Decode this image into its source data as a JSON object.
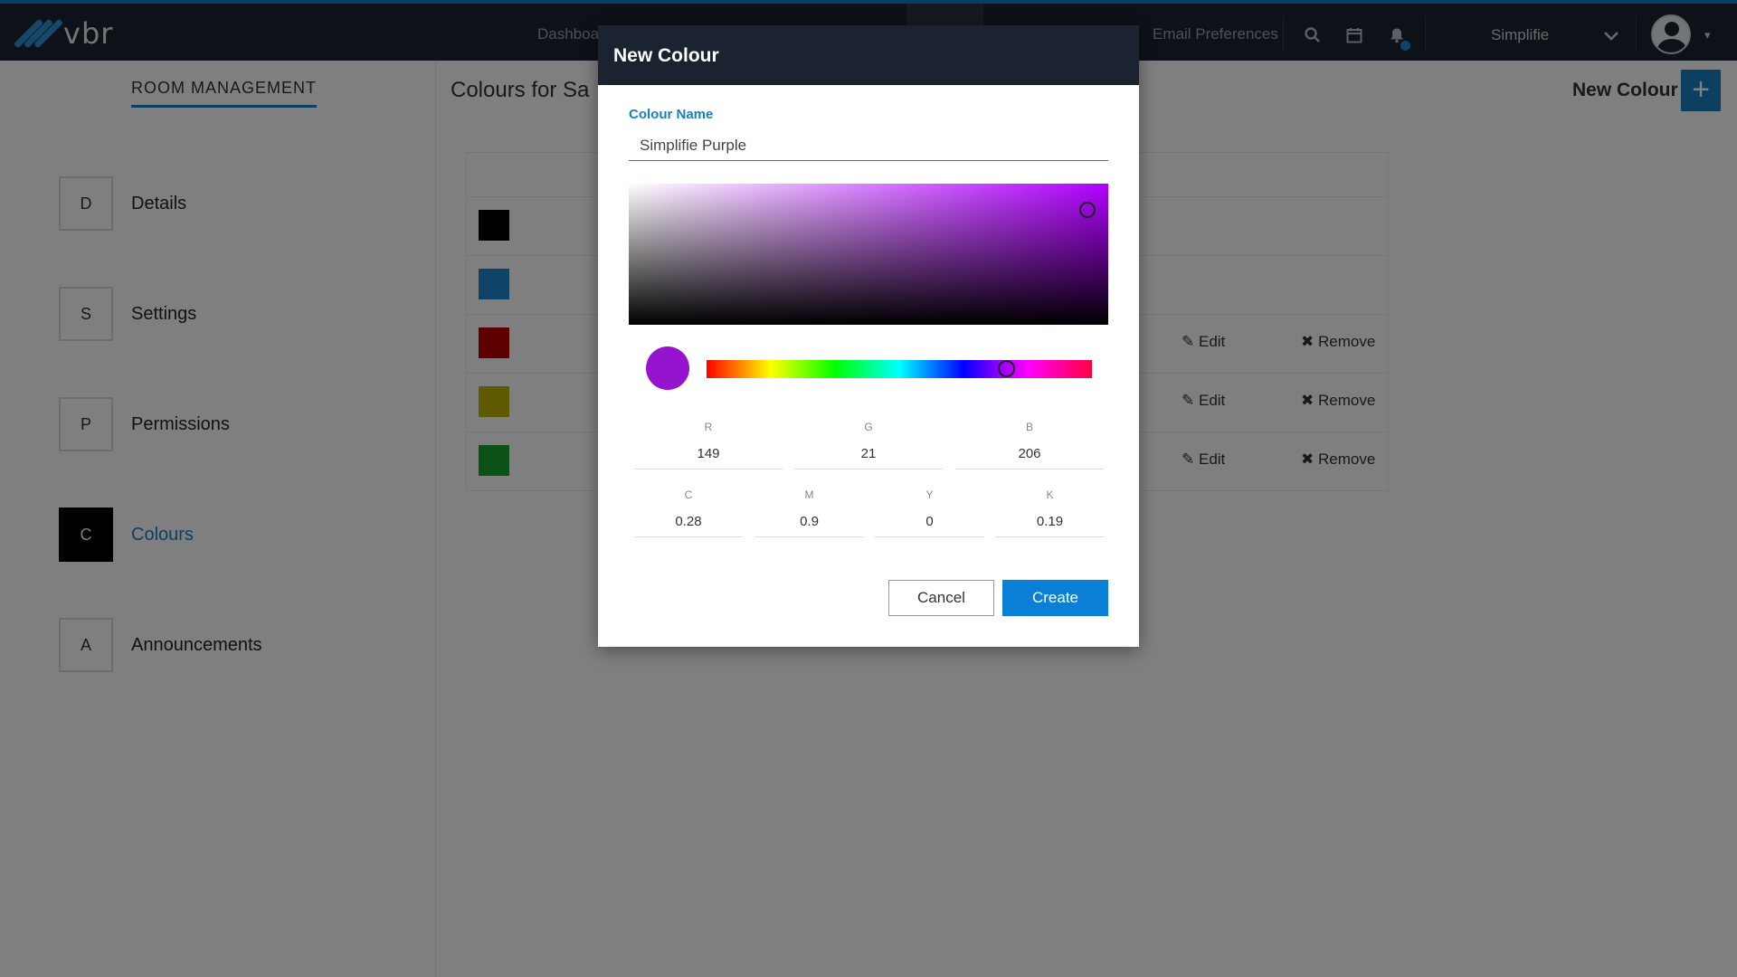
{
  "app": {
    "logo_text": "vbr"
  },
  "nav": {
    "dashboard_label": "Dashboard",
    "email_prefs_label": "Email Preferences",
    "user_name": "Simplifie",
    "chevron": "⌄",
    "caret": "▾"
  },
  "sidebar": {
    "title": "ROOM MANAGEMENT",
    "items": [
      {
        "letter": "D",
        "label": "Details"
      },
      {
        "letter": "S",
        "label": "Settings"
      },
      {
        "letter": "P",
        "label": "Permissions"
      },
      {
        "letter": "C",
        "label": "Colours"
      },
      {
        "letter": "A",
        "label": "Announcements"
      }
    ]
  },
  "main": {
    "title": "Colours for Sa",
    "new_colour_label": "New Colour",
    "new_colour_icon": "+",
    "rows": [
      {
        "color": "#000000",
        "edit": "",
        "remove": ""
      },
      {
        "color": "#1c84cf",
        "edit": "",
        "remove": ""
      },
      {
        "color": "#bb0000",
        "edit": "Edit",
        "remove": "Remove"
      },
      {
        "color": "#c0b600",
        "edit": "Edit",
        "remove": "Remove"
      },
      {
        "color": "#18a52c",
        "edit": "Edit",
        "remove": "Remove"
      }
    ],
    "edit_icon": "✎",
    "remove_icon": "✖"
  },
  "modal": {
    "title": "New Colour",
    "name_label": "Colour Name",
    "name_value": "Simplifie Purple",
    "preview_color": "#9515ce",
    "rgb": {
      "r_label": "R",
      "r": "149",
      "g_label": "G",
      "g": "21",
      "b_label": "B",
      "b": "206"
    },
    "cmyk": {
      "c_label": "C",
      "c": "0.28",
      "m_label": "M",
      "m": "0.9",
      "y_label": "Y",
      "y": "0",
      "k_label": "K",
      "k": "0.19"
    },
    "cancel_label": "Cancel",
    "create_label": "Create"
  }
}
